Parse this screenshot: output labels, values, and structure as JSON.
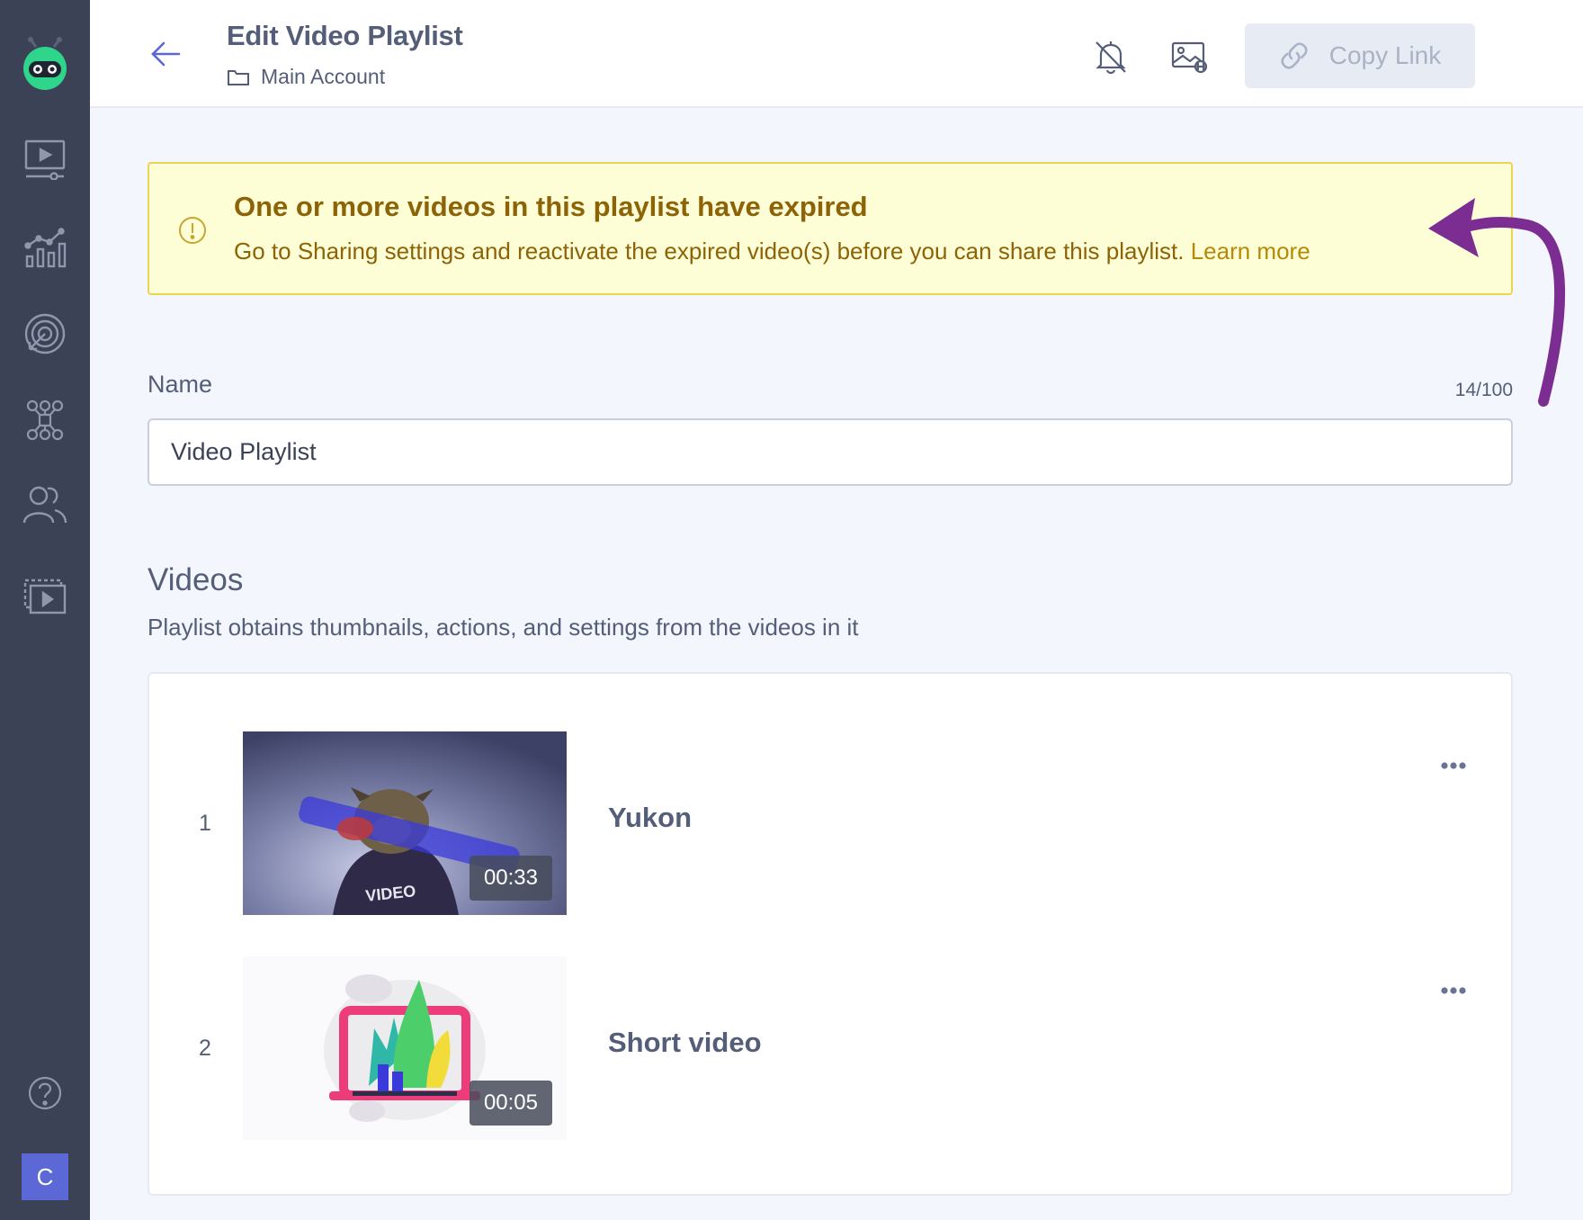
{
  "header": {
    "title": "Edit Video Playlist",
    "breadcrumb": "Main Account",
    "copy_link_label": "Copy Link"
  },
  "alert": {
    "title": "One or more videos in this playlist have expired",
    "message": "Go to Sharing settings and reactivate the expired video(s) before you can share this playlist.",
    "link": "Learn more"
  },
  "form": {
    "name_label": "Name",
    "name_counter": "14/100",
    "name_value": "Video Playlist"
  },
  "videos": {
    "title": "Videos",
    "subtitle": "Playlist obtains thumbnails, actions, and settings from the videos in it",
    "items": [
      {
        "index": "1",
        "title": "Yukon",
        "duration": "00:33"
      },
      {
        "index": "2",
        "title": "Short video",
        "duration": "00:05"
      }
    ]
  },
  "user": {
    "avatar_initial": "C"
  },
  "colors": {
    "sidebar": "#3b4256",
    "accent_avatar": "#5b68d6",
    "alert_bg": "#fefed6",
    "alert_text": "#8d6308",
    "annotation_arrow": "#7b2d91"
  },
  "icons": {
    "sidebar": [
      "logo-icon",
      "videos-icon",
      "analytics-icon",
      "engagement-icon",
      "integrations-icon",
      "contacts-icon",
      "playlists-icon",
      "help-icon"
    ],
    "header": [
      "back-arrow-icon",
      "bell-off-icon",
      "thumbnail-link-icon",
      "link-icon",
      "more-icon"
    ]
  }
}
